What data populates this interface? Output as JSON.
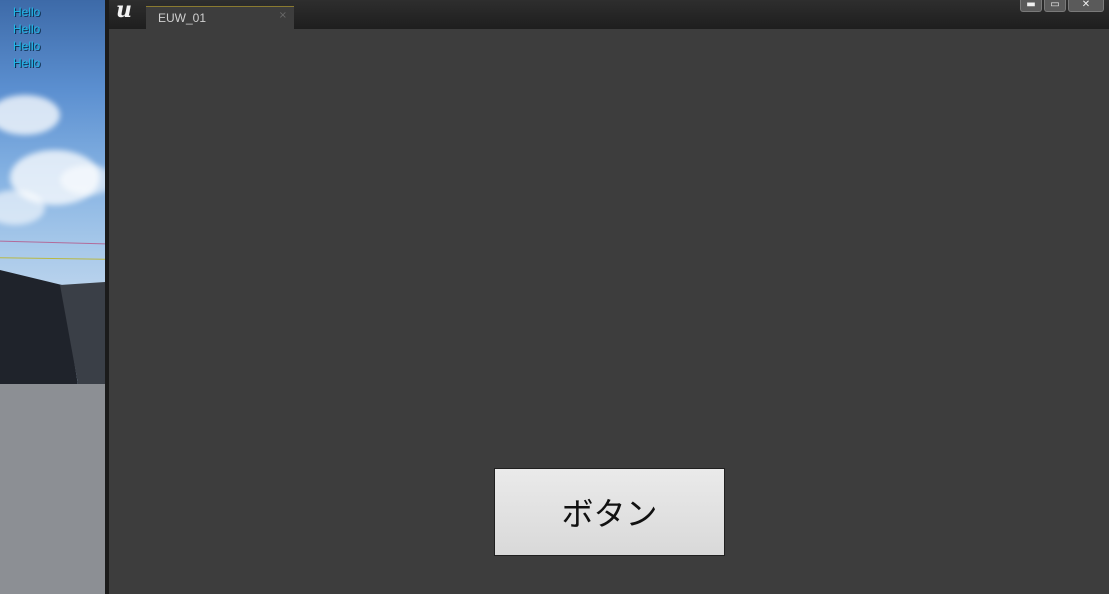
{
  "viewport": {
    "debug_messages": [
      "Hello",
      "Hello",
      "Hello",
      "Hello"
    ]
  },
  "editor": {
    "logo_icon": "unreal-engine-logo",
    "tab": {
      "label": "EUW_01",
      "close_glyph": "×"
    },
    "window_controls": {
      "minimize": "▬",
      "maximize": "▭",
      "close": "✕"
    },
    "button_label": "ボタン"
  },
  "colors": {
    "debug_text": "#1fb8e8",
    "editor_background": "#3d3d3d",
    "button_background": "#e0e0e0"
  }
}
